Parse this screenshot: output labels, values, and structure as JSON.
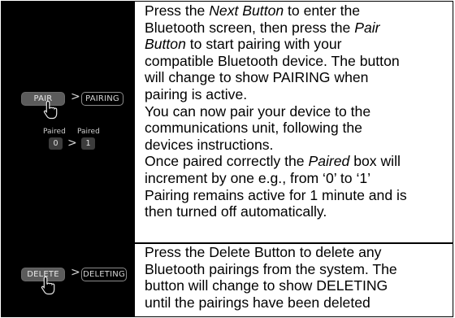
{
  "pair_row": {
    "button_before": "PAIR",
    "button_after": "PAIRING",
    "separator": ">",
    "paired_label_before": "Paired",
    "paired_value_before": "0",
    "paired_label_after": "Paired",
    "paired_value_after": "1",
    "text": {
      "l1a": "Press the ",
      "l1b": "Next Button",
      "l1c": " to enter the",
      "l2": "Bluetooth screen, then press the ",
      "l2em": "Pair",
      "l3em": "Button",
      "l3": " to start pairing with your",
      "l4": "compatible Bluetooth device.  The button",
      "l5": "will change to show PAIRING when",
      "l6": "pairing is active.",
      "l7": "You can now pair your device to the",
      "l8": "communications unit, following the",
      "l9": "devices instructions.",
      "l10a": "Once paired correctly the ",
      "l10em": "Paired",
      "l10b": " box will",
      "l11": "increment by one e.g., from ‘0’ to ‘1’",
      "l12": "Pairing remains active for 1 minute and is",
      "l13": "then turned off automatically."
    }
  },
  "delete_row": {
    "button_before": "DELETE",
    "button_after": "DELETING",
    "separator": ">",
    "text": {
      "l1": "Press the Delete Button to delete any",
      "l2": "Bluetooth pairings from the system.  The",
      "l3": "button will change to show DELETING",
      "l4": "until the pairings have been deleted"
    }
  },
  "icons": {
    "pointer": "hand-pointer-icon"
  }
}
